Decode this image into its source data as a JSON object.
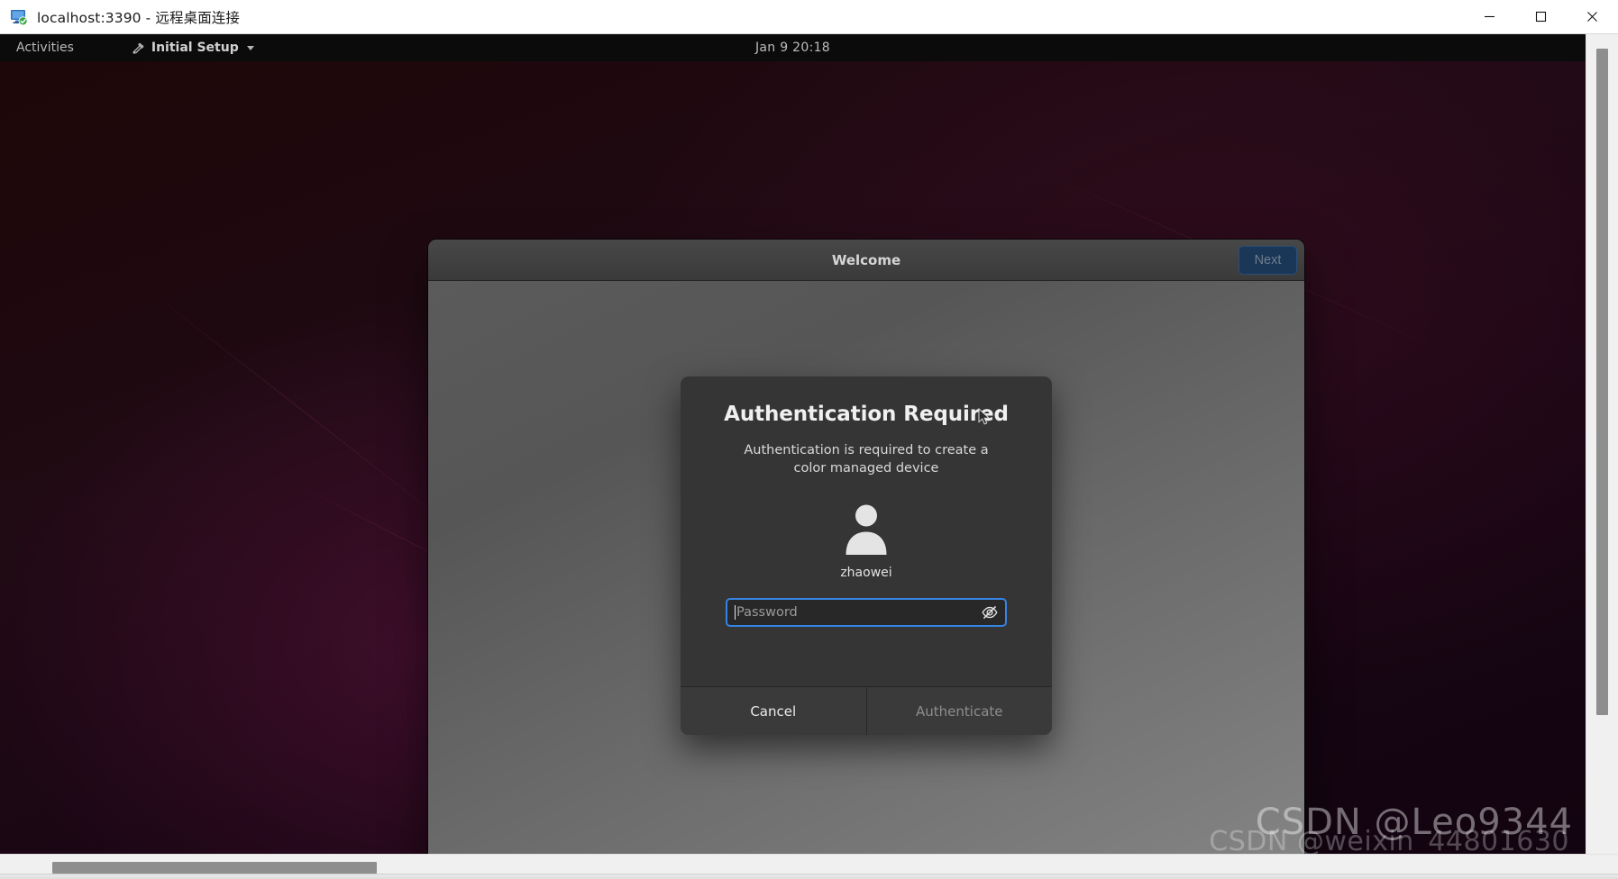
{
  "rdp_client": {
    "title": "localhost:3390 - 远程桌面连接",
    "icon": "remote-desktop-icon",
    "window_controls": {
      "minimize_label": "Minimize",
      "maximize_label": "Maximize",
      "close_label": "Close"
    }
  },
  "gnome": {
    "activities_label": "Activities",
    "app_menu_label": "Initial Setup",
    "app_menu_icon": "initial-setup-icon",
    "clock": "Jan 9  20:18"
  },
  "welcome_window": {
    "title": "Welcome",
    "next_label": "Next"
  },
  "auth_dialog": {
    "heading": "Authentication Required",
    "message": "Authentication is required to create a color managed device",
    "avatar_icon": "user-avatar-icon",
    "username": "zhaowei",
    "password_placeholder": "Password",
    "password_value": "",
    "reveal_icon": "eye-slash-icon",
    "cancel_label": "Cancel",
    "authenticate_label": "Authenticate"
  },
  "watermarks": {
    "primary": "CSDN @Leo9344",
    "secondary": "CSDN @weixin_44801630"
  },
  "colors": {
    "focus_blue": "#3584e4",
    "next_button_bg": "#1b3757",
    "dialog_bg": "#353535",
    "headerbar_bg": "#3a3a3a"
  }
}
